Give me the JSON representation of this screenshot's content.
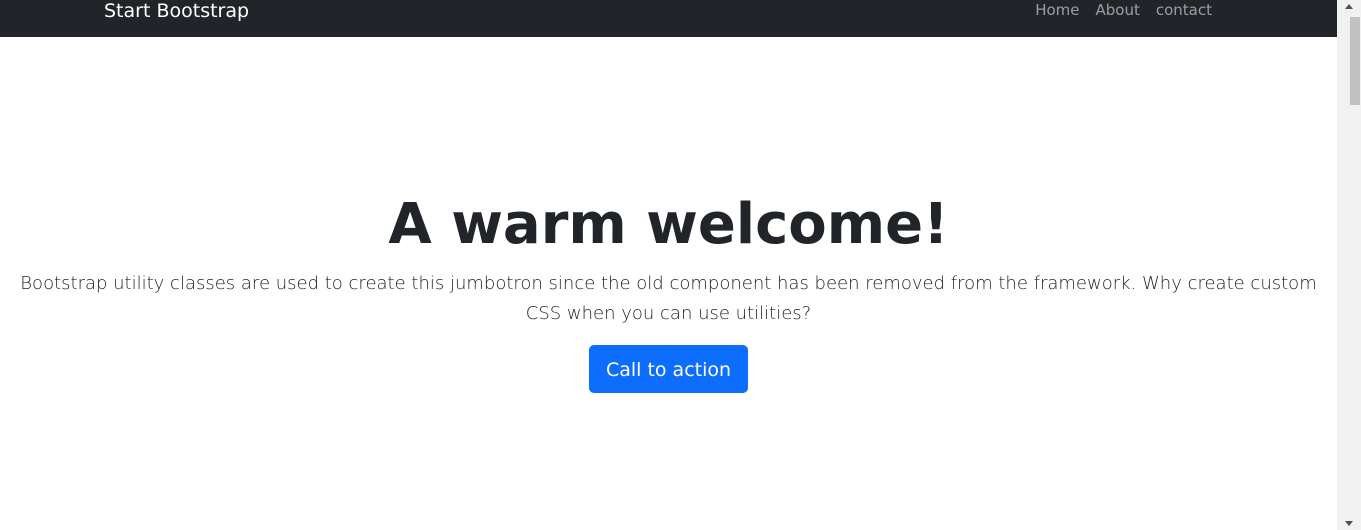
{
  "navbar": {
    "brand": "Start Bootstrap",
    "links": [
      {
        "label": "Home"
      },
      {
        "label": "About"
      },
      {
        "label": "contact"
      }
    ]
  },
  "hero": {
    "title": "A warm welcome!",
    "lead": "Bootstrap utility classes are used to create this jumbotron since the old component has been removed from the framework. Why create custom CSS when you can use utilities?",
    "cta_label": "Call to action"
  },
  "colors": {
    "navbar_bg": "#212529",
    "primary": "#0d6efd",
    "text": "#212529"
  },
  "icons": [
    "scroll-up-arrow-icon",
    "scroll-down-arrow-icon"
  ]
}
